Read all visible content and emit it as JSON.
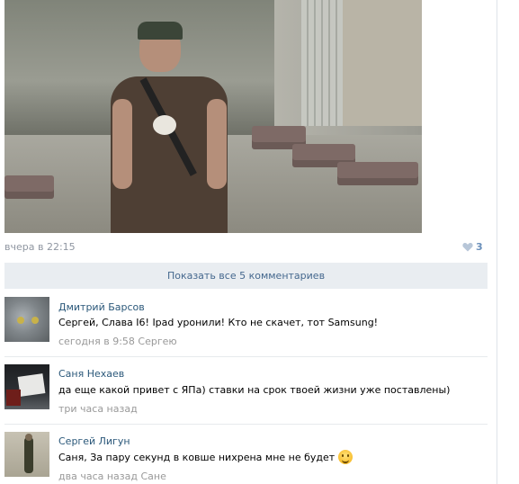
{
  "post": {
    "date": "вчера в 22:15",
    "likes": "3",
    "show_all_comments": "Показать все 5 комментариев"
  },
  "comments": [
    {
      "author": "Дмитрий Барсов",
      "text": "Сергей, Слава I6! Ipad уронили! Кто не скачет, тот Samsung!",
      "meta": "сегодня в 9:58 Сергею",
      "avatar": "cat-avatar"
    },
    {
      "author": "Саня Нехаев",
      "text": "да еще какой привет с ЯПа) ставки на срок твоей жизни уже поставлены)",
      "meta": "три часа назад",
      "avatar": "desk-avatar"
    },
    {
      "author": "Сергей Лигун",
      "text": "Саня, За пару секунд в ковше нихрена мне не будет",
      "meta": "два часа назад Сане",
      "avatar": "soldier-avatar",
      "emoji": "smile-emoji-icon"
    }
  ],
  "colors": {
    "link": "#2b587a",
    "meta": "#999999",
    "bar_bg": "#e9edf1",
    "bar_text": "#45688e",
    "like": "#6a8fba"
  }
}
